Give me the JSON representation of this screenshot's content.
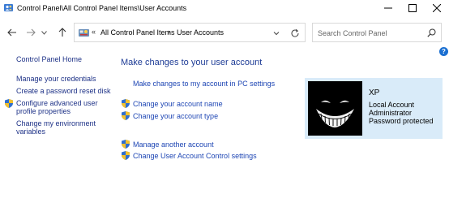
{
  "window": {
    "title": "Control Panel\\All Control Panel Items\\User Accounts"
  },
  "nav": {
    "breadcrumb_prefix": "«",
    "breadcrumb": [
      "All Control Panel Items",
      "User Accounts"
    ],
    "breadcrumb_separator": "›",
    "search_placeholder": "Search Control Panel"
  },
  "sidebar": {
    "home": "Control Panel Home",
    "items": [
      {
        "label": "Manage your credentials",
        "shield": false
      },
      {
        "label": "Create a password reset disk",
        "shield": false
      },
      {
        "label": "Configure advanced user profile properties",
        "shield": true
      },
      {
        "label": "Change my environment variables",
        "shield": false
      }
    ]
  },
  "main": {
    "title": "Make changes to your user account",
    "pc_settings_link": "Make changes to my account in PC settings",
    "links_group1": [
      {
        "label": "Change your account name",
        "shield": true
      },
      {
        "label": "Change your account type",
        "shield": true
      }
    ],
    "links_group2": [
      {
        "label": "Manage another account",
        "shield": true
      },
      {
        "label": "Change User Account Control settings",
        "shield": true
      }
    ]
  },
  "account": {
    "name": "XP",
    "type": "Local Account",
    "role": "Administrator",
    "password_status": "Password protected"
  },
  "help": {
    "label": "?"
  },
  "colors": {
    "link": "#1e3287",
    "title": "#1e3c96",
    "card_bg": "#d9ebf9",
    "help_bg": "#1a6fd1"
  },
  "icons": [
    "user-accounts-icon",
    "minimize-icon",
    "maximize-icon",
    "close-icon",
    "back-arrow-icon",
    "forward-arrow-icon",
    "recent-dropdown-icon",
    "up-arrow-icon",
    "control-panel-icon",
    "chevron-down-icon",
    "refresh-icon",
    "search-icon",
    "uac-shield-icon",
    "help-icon"
  ]
}
